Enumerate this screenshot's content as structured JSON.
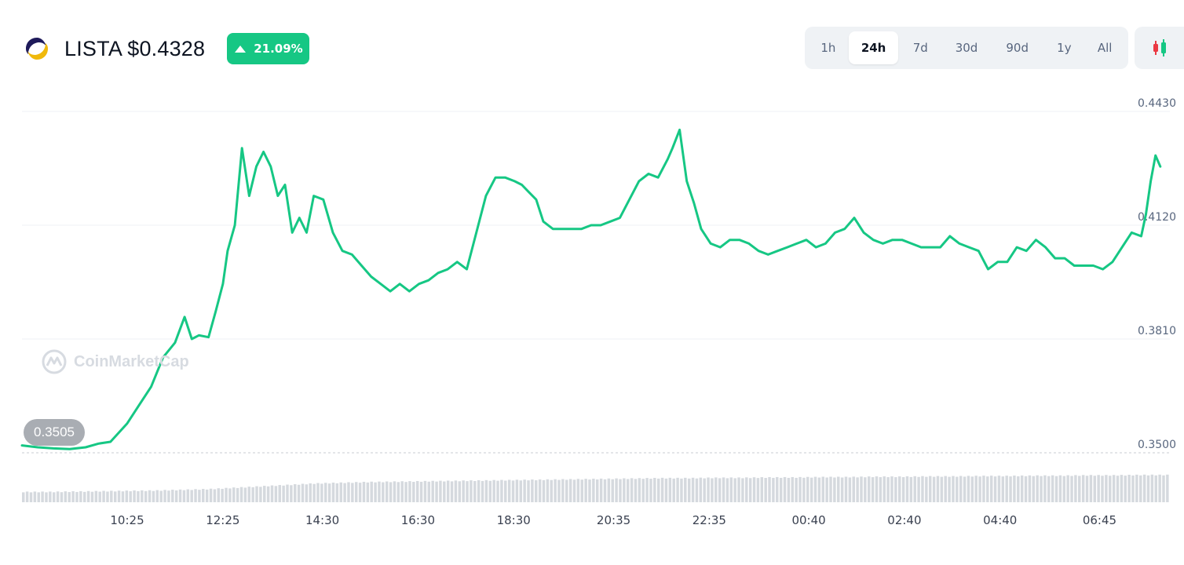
{
  "header": {
    "title": "LISTA $0.4328",
    "change_pct": "21.09%",
    "logo_icon": "lista-logo-icon",
    "change_icon": "triangle-up-icon"
  },
  "colors": {
    "up": "#16c784",
    "grid": "#eff2f5",
    "axis_text": "#58667e",
    "volume": "#d5d9de"
  },
  "timeframes": [
    {
      "label": "1h",
      "active": false
    },
    {
      "label": "24h",
      "active": true
    },
    {
      "label": "7d",
      "active": false
    },
    {
      "label": "30d",
      "active": false
    },
    {
      "label": "90d",
      "active": false
    },
    {
      "label": "1y",
      "active": false
    },
    {
      "label": "All",
      "active": false
    }
  ],
  "candle_toggle_icon": "candlestick-icon",
  "watermark": "CoinMarketCap",
  "current_label": "0.3505",
  "chart_data": {
    "type": "line",
    "ylim": [
      0.35,
      0.443
    ],
    "y_ticks": [
      "0.4430",
      "0.4120",
      "0.3810",
      "0.3500"
    ],
    "y_tick_values": [
      0.443,
      0.412,
      0.381,
      0.35
    ],
    "x_ticks": [
      "10:25",
      "12:25",
      "14:30",
      "16:30",
      "18:30",
      "20:35",
      "22:35",
      "00:40",
      "02:40",
      "04:40",
      "06:45"
    ],
    "x_tick_positions": [
      2.2,
      4.2,
      6.28,
      8.28,
      10.28,
      12.37,
      14.37,
      16.45,
      18.45,
      20.45,
      22.53
    ],
    "xlim": [
      0,
      24
    ],
    "grid": true,
    "series": [
      {
        "x": [
          0,
          0.33,
          0.66,
          1.0,
          1.33,
          1.6,
          1.85,
          2.2,
          2.45,
          2.7,
          2.95,
          3.2,
          3.4,
          3.55,
          3.7,
          3.9,
          4.05,
          4.2,
          4.3,
          4.45,
          4.6,
          4.75,
          4.9,
          5.05,
          5.2,
          5.35,
          5.5,
          5.65,
          5.8,
          5.95,
          6.1,
          6.3,
          6.5,
          6.7,
          6.9,
          7.1,
          7.3,
          7.5,
          7.7,
          7.9,
          8.1,
          8.3,
          8.5,
          8.7,
          8.9,
          9.1,
          9.3,
          9.5,
          9.7,
          9.9,
          10.1,
          10.3,
          10.45,
          10.6,
          10.75,
          10.9,
          11.1,
          11.3,
          11.5,
          11.7,
          11.9,
          12.1,
          12.3,
          12.5,
          12.7,
          12.9,
          13.1,
          13.3,
          13.5,
          13.6,
          13.75,
          13.9,
          14.05,
          14.2,
          14.4,
          14.6,
          14.8,
          15.0,
          15.2,
          15.4,
          15.6,
          15.8,
          16.0,
          16.2,
          16.4,
          16.6,
          16.8,
          17.0,
          17.2,
          17.4,
          17.6,
          17.8,
          18.0,
          18.2,
          18.4,
          18.6,
          18.8,
          19.0,
          19.2,
          19.4,
          19.6,
          19.8,
          20.0,
          20.2,
          20.4,
          20.6,
          20.8,
          21.0,
          21.2,
          21.4,
          21.6,
          21.8,
          22.0,
          22.2,
          22.4,
          22.6,
          22.8,
          23.0,
          23.2,
          23.4,
          23.5,
          23.6,
          23.7,
          23.8
        ],
        "values": [
          0.352,
          0.3515,
          0.3512,
          0.351,
          0.3515,
          0.3525,
          0.353,
          0.358,
          0.363,
          0.368,
          0.376,
          0.38,
          0.387,
          0.381,
          0.382,
          0.3815,
          0.3885,
          0.396,
          0.405,
          0.412,
          0.433,
          0.42,
          0.428,
          0.432,
          0.428,
          0.42,
          0.423,
          0.41,
          0.414,
          0.41,
          0.42,
          0.419,
          0.41,
          0.405,
          0.404,
          0.401,
          0.398,
          0.396,
          0.394,
          0.396,
          0.394,
          0.396,
          0.397,
          0.399,
          0.4,
          0.402,
          0.4,
          0.41,
          0.42,
          0.425,
          0.425,
          0.424,
          0.423,
          0.421,
          0.419,
          0.413,
          0.411,
          0.411,
          0.411,
          0.411,
          0.412,
          0.412,
          0.413,
          0.414,
          0.419,
          0.424,
          0.426,
          0.425,
          0.43,
          0.433,
          0.438,
          0.424,
          0.418,
          0.411,
          0.407,
          0.406,
          0.408,
          0.408,
          0.407,
          0.405,
          0.404,
          0.405,
          0.406,
          0.407,
          0.408,
          0.406,
          0.407,
          0.41,
          0.411,
          0.414,
          0.41,
          0.408,
          0.407,
          0.408,
          0.408,
          0.407,
          0.406,
          0.406,
          0.406,
          0.409,
          0.407,
          0.406,
          0.405,
          0.4,
          0.402,
          0.402,
          0.406,
          0.405,
          0.408,
          0.406,
          0.403,
          0.403,
          0.401,
          0.401,
          0.401,
          0.4,
          0.402,
          0.406,
          0.41,
          0.409,
          0.415,
          0.424,
          0.431,
          0.428
        ]
      }
    ],
    "volume_values": [
      0.28,
      0.28,
      0.29,
      0.3,
      0.31,
      0.32,
      0.34,
      0.36,
      0.4,
      0.44,
      0.48,
      0.52,
      0.54,
      0.56,
      0.57,
      0.58,
      0.59,
      0.6,
      0.61,
      0.62,
      0.63,
      0.64,
      0.65,
      0.66,
      0.67,
      0.67,
      0.68,
      0.68,
      0.69,
      0.69,
      0.7,
      0.7,
      0.71,
      0.71,
      0.72,
      0.72,
      0.73,
      0.73,
      0.74,
      0.74,
      0.75,
      0.75,
      0.76,
      0.76
    ]
  }
}
